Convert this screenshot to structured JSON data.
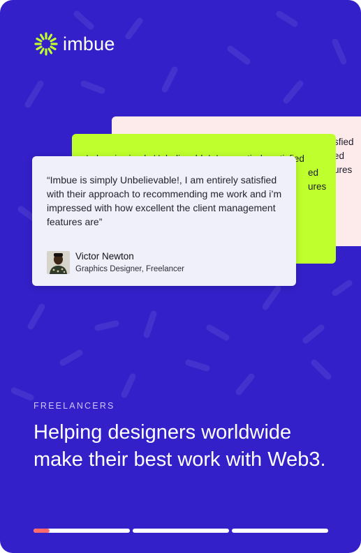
{
  "brand": {
    "name": "imbue",
    "accent_color": "#bfff2e",
    "background_color": "#3320c9",
    "icon": "sunburst-logo-icon"
  },
  "testimonials": {
    "back_card_partial_text": [
      "sfied",
      "ed",
      "ures"
    ],
    "middle_card_partial_text": [
      "Imbue is simply Unbelievable!, I am entirely satisfied",
      "ed",
      "ures"
    ],
    "front": {
      "quote": "“Imbue is simply Unbelievable!, I am entirely satisfied with their approach to recommending me work and i’m impressed with how excellent the client management features are”",
      "author_name": "Victor Newton",
      "author_role": "Graphics Designer, Freelancer",
      "avatar_icon": "avatar-photo-icon"
    }
  },
  "hero": {
    "eyebrow": "FREELANCERS",
    "headline": "Helping designers worldwide make their best work with Web3."
  },
  "carousel": {
    "segments": 3,
    "active_index": 0,
    "active_progress": 0.17,
    "active_color": "#ff6b6b"
  }
}
